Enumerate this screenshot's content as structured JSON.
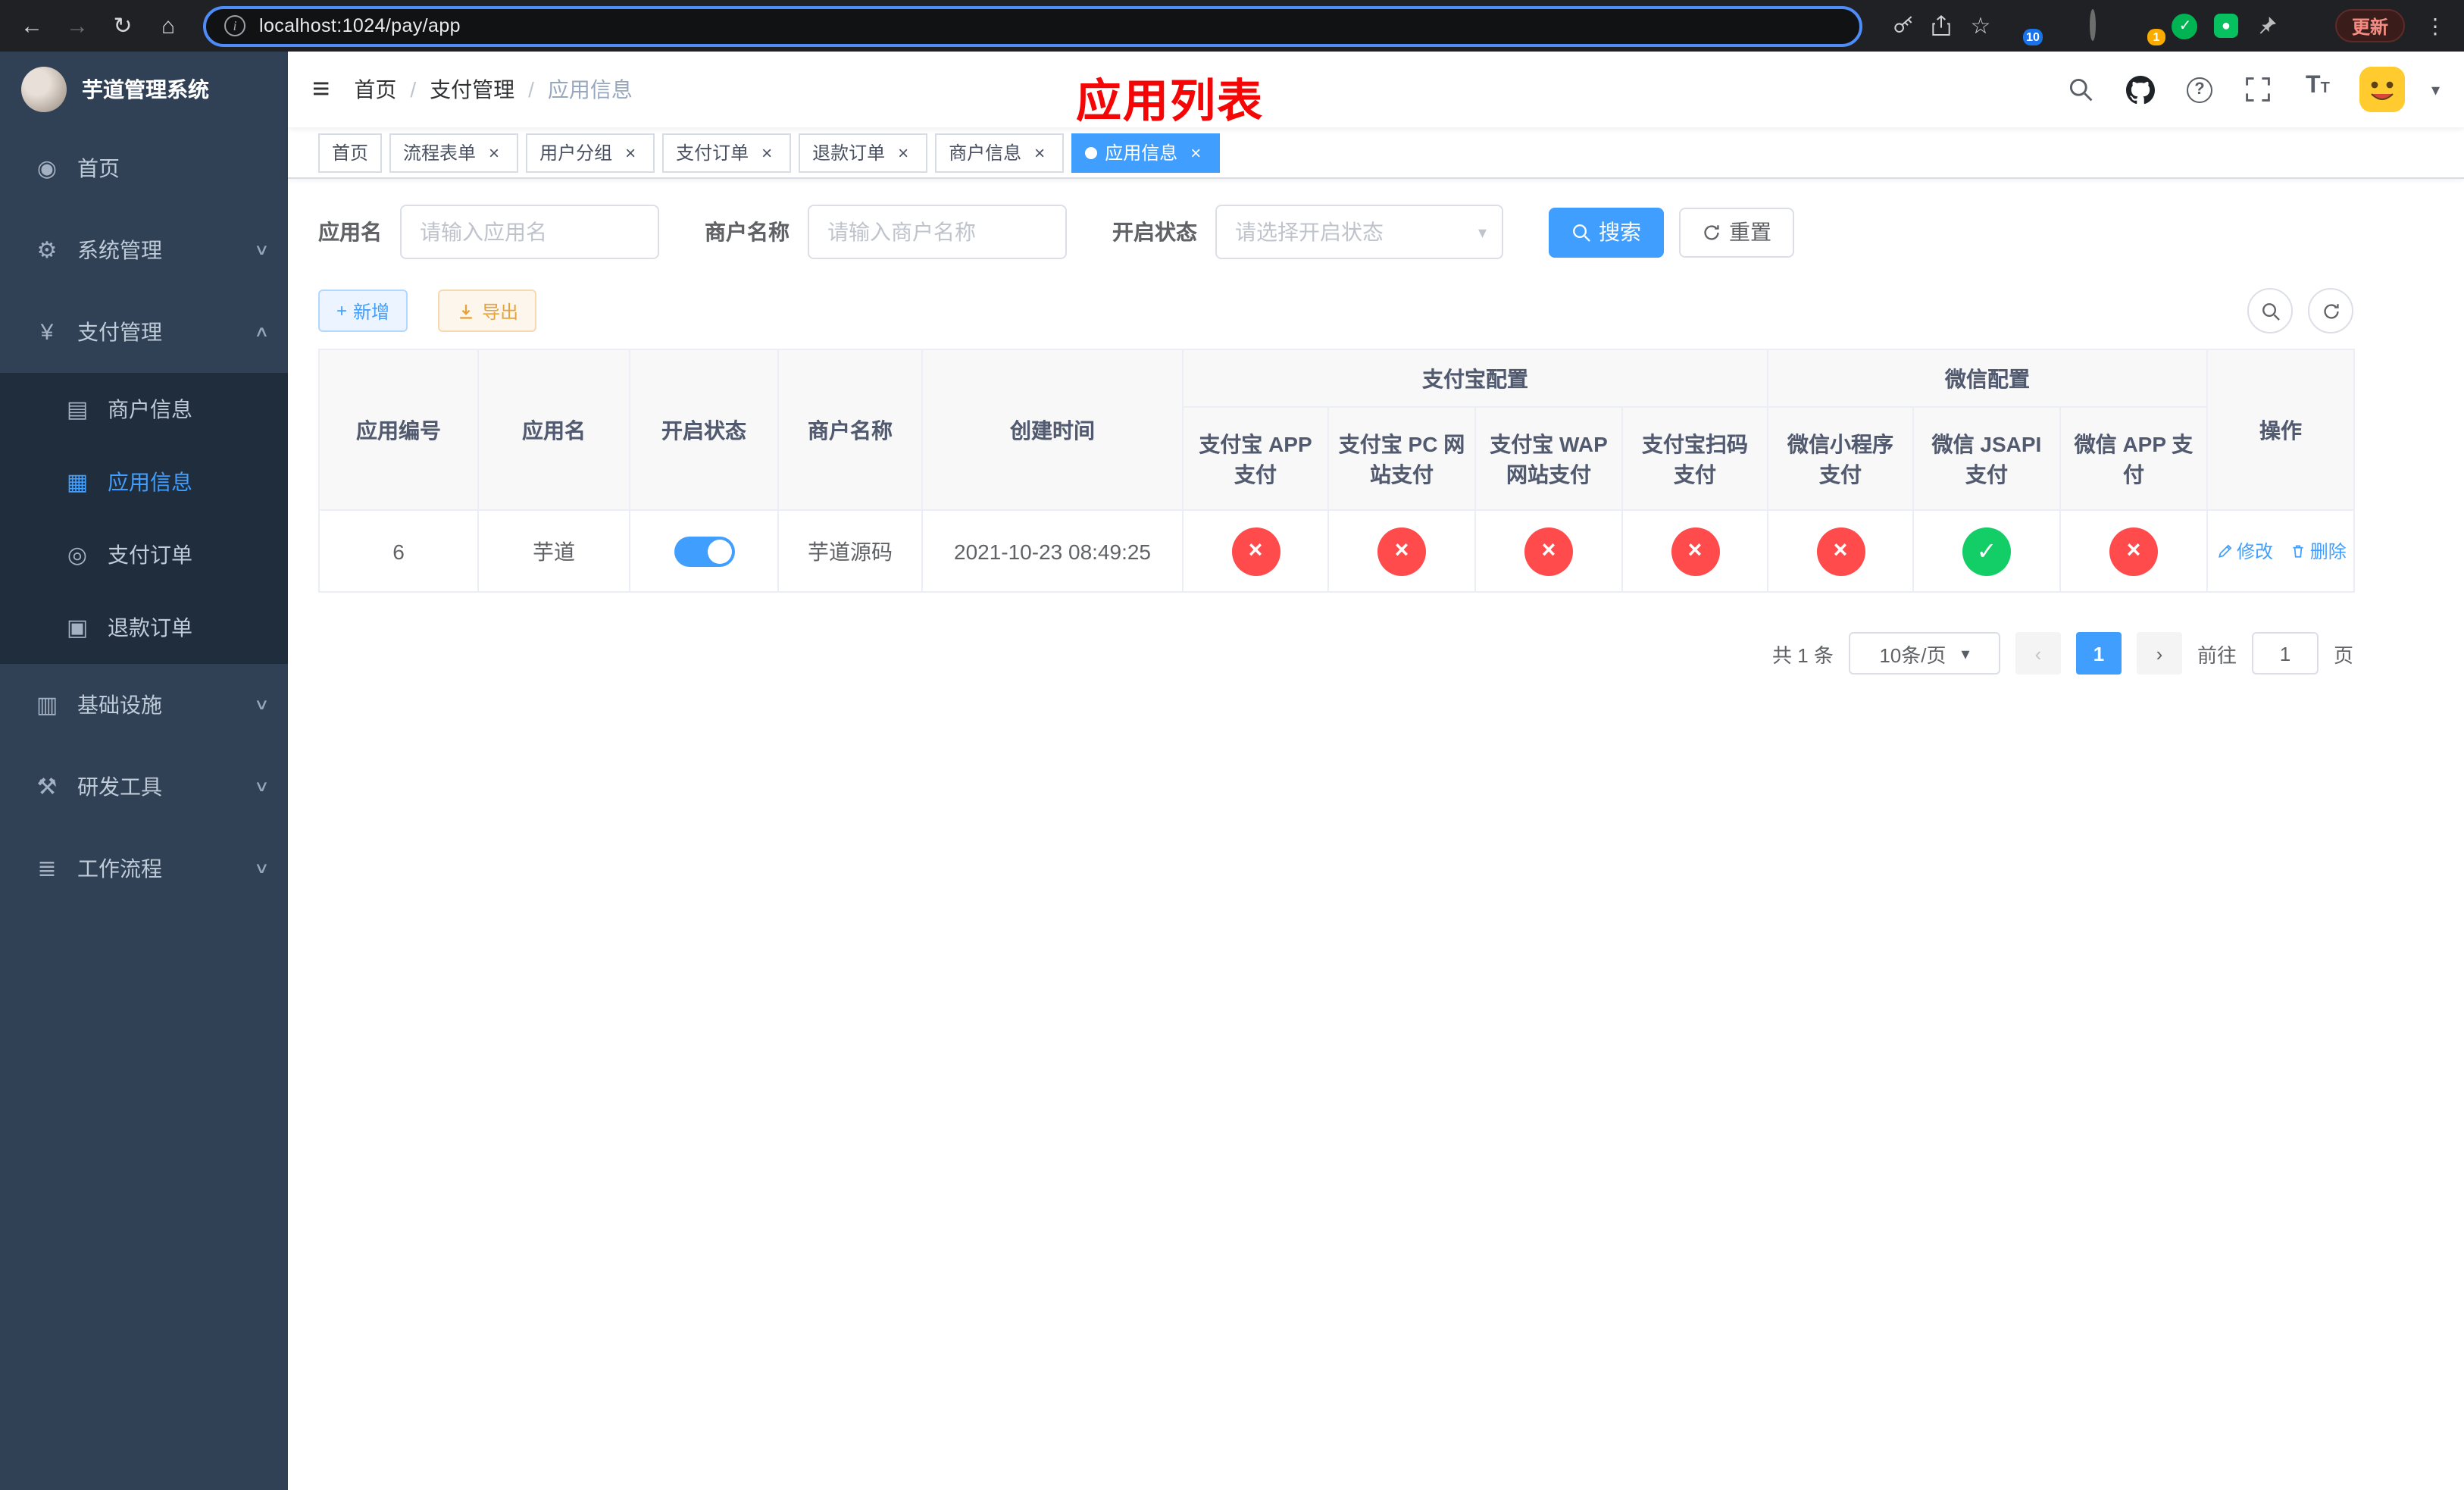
{
  "browser": {
    "url": "localhost:1024/pay/app",
    "update_label": "更新",
    "extension_badges": {
      "grid": "10",
      "avatar": "1"
    }
  },
  "icons": {
    "back": "←",
    "forward": "→",
    "reload": "↻",
    "home": "⌂",
    "info": "i",
    "star": "☆",
    "menu_dots": "⋮",
    "hamburger": "≡",
    "dashboard": "◉",
    "gear": "⚙",
    "yen": "¥",
    "card": "▤",
    "grid": "▦",
    "order": "◎",
    "refund": "▣",
    "infra": "▥",
    "tools": "⚒",
    "flow": "≣",
    "chevron_down": "∨",
    "chevron_up": "∧",
    "caret_down": "▾",
    "close": "×",
    "cross": "×",
    "check": "✓",
    "plus": "+",
    "prev": "‹",
    "next": "›",
    "question": "?",
    "font_big": "T",
    "font_small": "T",
    "check_small": "✓"
  },
  "sidebar": {
    "app_title": "芋道管理系统",
    "items": [
      {
        "label": "首页"
      },
      {
        "label": "系统管理"
      },
      {
        "label": "支付管理"
      },
      {
        "label": "商户信息"
      },
      {
        "label": "应用信息"
      },
      {
        "label": "支付订单"
      },
      {
        "label": "退款订单"
      },
      {
        "label": "基础设施"
      },
      {
        "label": "研发工具"
      },
      {
        "label": "工作流程"
      }
    ]
  },
  "header": {
    "breadcrumb": [
      "首页",
      "支付管理",
      "应用信息"
    ],
    "page_title": "应用列表"
  },
  "tabs": [
    {
      "label": "首页"
    },
    {
      "label": "流程表单"
    },
    {
      "label": "用户分组"
    },
    {
      "label": "支付订单"
    },
    {
      "label": "退款订单"
    },
    {
      "label": "商户信息"
    },
    {
      "label": "应用信息"
    }
  ],
  "filters": {
    "app_name_label": "应用名",
    "app_name_placeholder": "请输入应用名",
    "merchant_name_label": "商户名称",
    "merchant_name_placeholder": "请输入商户名称",
    "status_label": "开启状态",
    "status_placeholder": "请选择开启状态",
    "search_label": "搜索",
    "reset_label": "重置"
  },
  "toolbar": {
    "add_label": "新增",
    "export_label": "导出"
  },
  "table": {
    "groups": {
      "alipay": "支付宝配置",
      "wechat": "微信配置"
    },
    "columns": [
      "应用编号",
      "应用名",
      "开启状态",
      "商户名称",
      "创建时间",
      "支付宝 APP 支付",
      "支付宝 PC 网站支付",
      "支付宝 WAP 网站支付",
      "支付宝扫码支付",
      "微信小程序支付",
      "微信 JSAPI 支付",
      "微信 APP 支付",
      "操作"
    ],
    "row": {
      "id": "6",
      "name": "芋道",
      "status_on": true,
      "merchant": "芋道源码",
      "created": "2021-10-23 08:49:25",
      "configs": [
        "no",
        "no",
        "no",
        "no",
        "no",
        "yes",
        "no"
      ],
      "edit_label": "修改",
      "delete_label": "删除"
    }
  },
  "pagination": {
    "total": "共 1 条",
    "page_size": "10条/页",
    "current_page": "1",
    "goto_label": "前往",
    "goto_value": "1",
    "page_label": "页"
  }
}
